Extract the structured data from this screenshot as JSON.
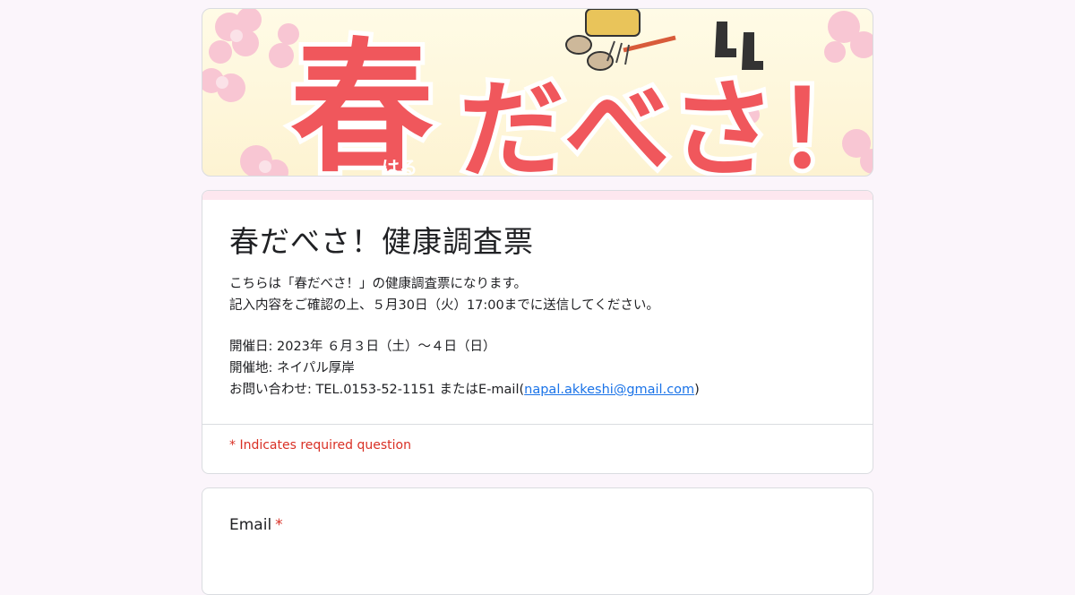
{
  "banner": {
    "headline_kanji": "春",
    "headline_kana": "だべさ！",
    "furigana": "はる"
  },
  "form": {
    "title": "春だべさ！健康調査票",
    "description": {
      "intro_1": "こちらは「春だべさ！」の健康調査票になります。",
      "intro_2": "記入内容をご確認の上、５月30日（火）17:00までに送信してください。",
      "date": "開催日: 2023年 ６月３日（土）～４日（日）",
      "venue": "開催地: ネイパル厚岸",
      "contact_prefix": "お問い合わせ: TEL.0153-52-1151 またはE-mail(",
      "contact_email": "napal.akkeshi@gmail.com",
      "contact_suffix": ")"
    },
    "required_note": "* Indicates required question"
  },
  "questions": [
    {
      "label": "Email",
      "required_mark": "*"
    }
  ],
  "colors": {
    "page_bg": "#fbf5fb",
    "banner_text": "#f0575c",
    "required_red": "#d93025",
    "link_blue": "#1a73e8",
    "title_card_accent": "#fde7ef"
  }
}
